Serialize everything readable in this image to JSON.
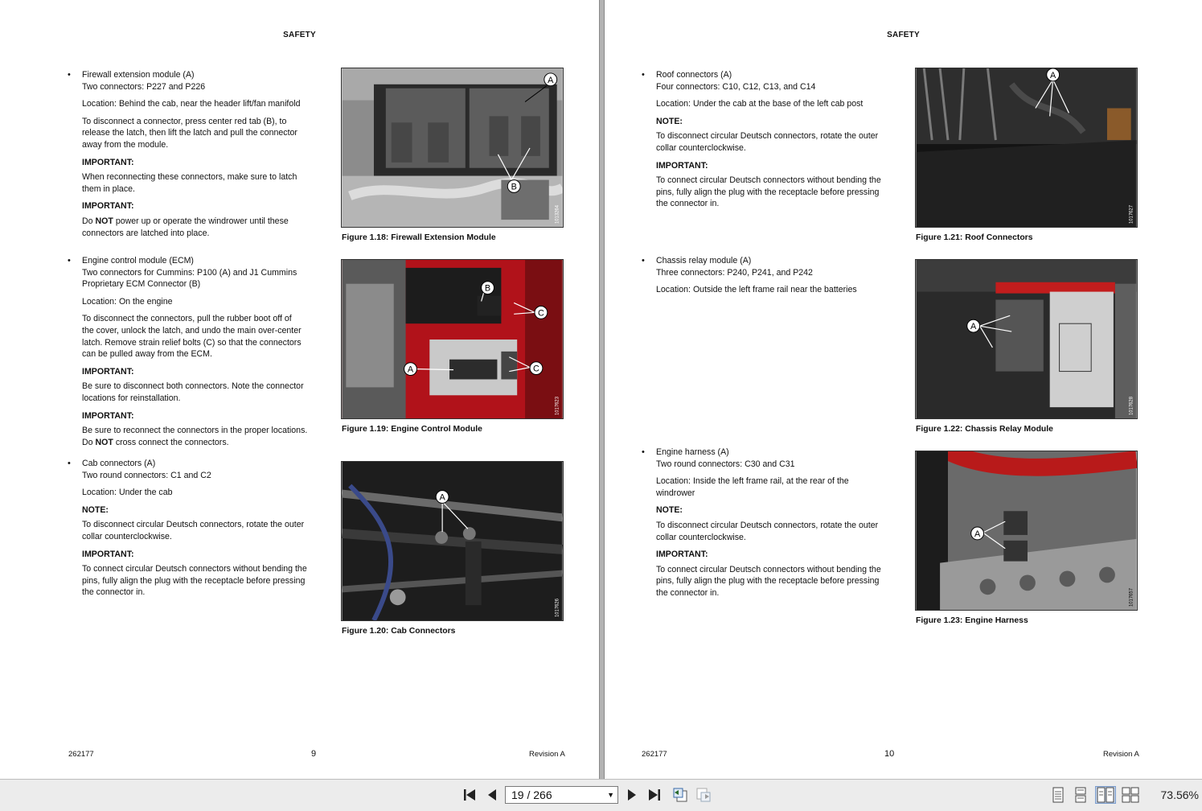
{
  "left": {
    "header": "SAFETY",
    "section1": {
      "lines": [
        "Firewall extension module (A)",
        "Two connectors: P227 and P226"
      ],
      "location": "Location: Behind the cab, near the header lift/fan manifold",
      "instructions": [
        "To disconnect a connector, press center red tab (B), to",
        "release the latch, then lift the latch and pull the connector",
        "away from the module."
      ],
      "important1_label": "IMPORTANT:",
      "important1_lines": [
        "When reconnecting these connectors, make sure to latch",
        "them in place."
      ],
      "important2_label": "IMPORTANT:",
      "important2_pre": "Do ",
      "important2_bold": "NOT",
      "important2_post": " power up or operate the windrower until these",
      "important2_line2": "connectors are latched into place."
    },
    "section2": {
      "lines": [
        "Engine control module (ECM)",
        "Two connectors for Cummins: P100 (A) and J1 Cummins",
        "Proprietary ECM Connector (B)"
      ],
      "location": "Location: On the engine",
      "instructions": [
        "To disconnect the connectors, pull the rubber boot off of",
        "the cover, unlock the latch, and undo the main over-center",
        "latch. Remove strain relief bolts (C) so that the connectors",
        "can be pulled away from the ECM."
      ],
      "important1_label": "IMPORTANT:",
      "important1_lines": [
        "Be sure to disconnect both connectors. Note the connector",
        "locations for reinstallation."
      ],
      "important2_label": "IMPORTANT:",
      "important2_line1": "Be sure to reconnect the connectors in the proper locations.",
      "important2_pre": "Do ",
      "important2_bold": "NOT",
      "important2_post": " cross connect the connectors."
    },
    "section3": {
      "lines": [
        "Cab connectors (A)",
        "Two round connectors: C1 and C2"
      ],
      "location": "Location: Under the cab",
      "note_label": "NOTE:",
      "note_lines": [
        "To disconnect circular Deutsch connectors, rotate the outer",
        "collar counterclockwise."
      ],
      "important_label": "IMPORTANT:",
      "important_lines": [
        "To connect circular Deutsch connectors without bending the",
        "pins, fully align the plug with the receptacle before pressing",
        "the connector in."
      ]
    },
    "figures": [
      {
        "caption": "Figure 1.18: Firewall Extension Module",
        "callouts": [
          "A",
          "B"
        ],
        "id_code": "1013264"
      },
      {
        "caption": "Figure 1.19: Engine Control Module",
        "callouts": [
          "B",
          "C",
          "A",
          "C"
        ],
        "id_code": "1017623"
      },
      {
        "caption": "Figure 1.20: Cab Connectors",
        "callouts": [
          "A"
        ],
        "id_code": "1017626"
      }
    ],
    "footer": {
      "doc": "262177",
      "page": "9",
      "revision": "Revision  A"
    }
  },
  "right": {
    "header": "SAFETY",
    "section1": {
      "lines": [
        "Roof connectors (A)",
        "Four connectors: C10, C12, C13, and C14"
      ],
      "location": "Location: Under the cab at the base of the left cab post",
      "note_label": "NOTE:",
      "note_lines": [
        "To disconnect circular Deutsch connectors, rotate the outer",
        "collar counterclockwise."
      ],
      "important_label": "IMPORTANT:",
      "important_lines": [
        "To connect circular Deutsch connectors without bending the",
        "pins, fully align the plug with the receptacle before pressing",
        "the connector in."
      ]
    },
    "section2": {
      "lines": [
        "Chassis relay module (A)",
        "Three connectors: P240, P241, and P242"
      ],
      "location": "Location: Outside the left frame rail near the batteries"
    },
    "section3": {
      "lines": [
        "Engine harness (A)",
        "Two round connectors: C30 and C31"
      ],
      "location_lines": [
        "Location: Inside the left frame rail, at the rear of the",
        "windrower"
      ],
      "note_label": "NOTE:",
      "note_lines": [
        "To disconnect circular Deutsch connectors, rotate the outer",
        "collar counterclockwise."
      ],
      "important_label": "IMPORTANT:",
      "important_lines": [
        "To connect circular Deutsch connectors without bending the",
        "pins, fully align the plug with the receptacle before pressing",
        "the connector in."
      ]
    },
    "figures": [
      {
        "caption": "Figure 1.21: Roof Connectors",
        "callouts": [
          "A"
        ],
        "id_code": "1017627"
      },
      {
        "caption": "Figure 1.22: Chassis Relay Module",
        "callouts": [
          "A"
        ],
        "id_code": "1017628"
      },
      {
        "caption": "Figure 1.23: Engine Harness",
        "callouts": [
          "A"
        ],
        "id_code": "1017657"
      }
    ],
    "footer": {
      "doc": "262177",
      "page": "10",
      "revision": "Revision  A"
    }
  },
  "toolbar": {
    "page_indicator": "19 / 266",
    "zoom": "73.56%",
    "icons": [
      "first-page-icon",
      "previous-page-icon",
      "next-page-icon",
      "last-page-icon",
      "previous-view-icon",
      "next-view-icon",
      "single-page-icon",
      "continuous-icon",
      "two-page-icon",
      "two-page-continuous-icon"
    ]
  }
}
